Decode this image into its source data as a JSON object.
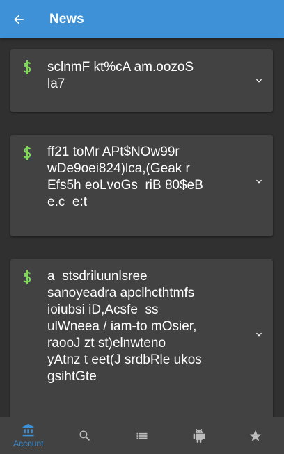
{
  "app_bar": {
    "title": "News",
    "back_icon": "arrow-back-icon",
    "background": "#3e91d6"
  },
  "cards": [
    {
      "icon": "dollar-icon",
      "text": "sclnmF kt%cA am.oozoS\nla7",
      "expand_icon": "chevron-down-icon"
    },
    {
      "icon": "dollar-icon",
      "text": "ff21 toMr APt$NOw99r\nwDe9oei824)lca,(Geak r\nEfs5h eoLvoGs  riB 80$eB\ne.c  e:t",
      "expand_icon": "chevron-down-icon"
    },
    {
      "icon": "dollar-icon",
      "text": "a  stsdriluunlsree\nsanoyeadra apclhcthtmfs\nioiubsi iD,Acsfe  ss\nulWneea / iam-to mOsier,\nraooJ zt st)elnwteno\nyAtnz t eet(J srdbRle ukos\ngsihtGte",
      "expand_icon": "chevron-down-icon"
    }
  ],
  "bottom_nav": {
    "items": [
      {
        "icon": "bank-icon",
        "label": "Account",
        "active": true
      },
      {
        "icon": "search-icon",
        "label": "",
        "active": false
      },
      {
        "icon": "list-icon",
        "label": "",
        "active": false
      },
      {
        "icon": "android-icon",
        "label": "",
        "active": false
      },
      {
        "icon": "star-icon",
        "label": "",
        "active": false
      }
    ]
  },
  "colors": {
    "accent": "#3e91d6",
    "dollar_green": "#7ed957",
    "background": "#303030",
    "card": "#424242",
    "inactive_icon": "#bdbdbd"
  }
}
